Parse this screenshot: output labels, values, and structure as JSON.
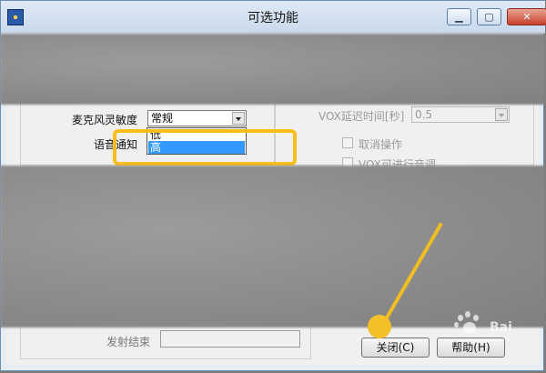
{
  "window": {
    "title": "可选功能"
  },
  "titlebar": {
    "minimize_icon": "minimize-icon",
    "maximize_icon": "maximize-icon",
    "close_icon": "close-icon"
  },
  "form": {
    "mic_sensitivity_label": "麦克风灵敏度",
    "mic_sensitivity_value": "常规",
    "voice_notify_label": "语音通知",
    "vox_delay_label": "VOX延迟时间[秒]",
    "vox_delay_value": "0.5",
    "cancel_operation_label": "取消操作",
    "vox_adjust_label": "VOX可进行音调",
    "transmit_end_label": "发射结束"
  },
  "dropdown": {
    "options": [
      {
        "label": "低",
        "selected": false
      },
      {
        "label": "高",
        "selected": true
      }
    ]
  },
  "buttons": {
    "close_label": "关闭(C)",
    "help_label": "帮助(H)"
  },
  "watermark": {
    "text": "Bai"
  },
  "colors": {
    "highlight": "#f7bf1e",
    "selection": "#3399ff"
  }
}
